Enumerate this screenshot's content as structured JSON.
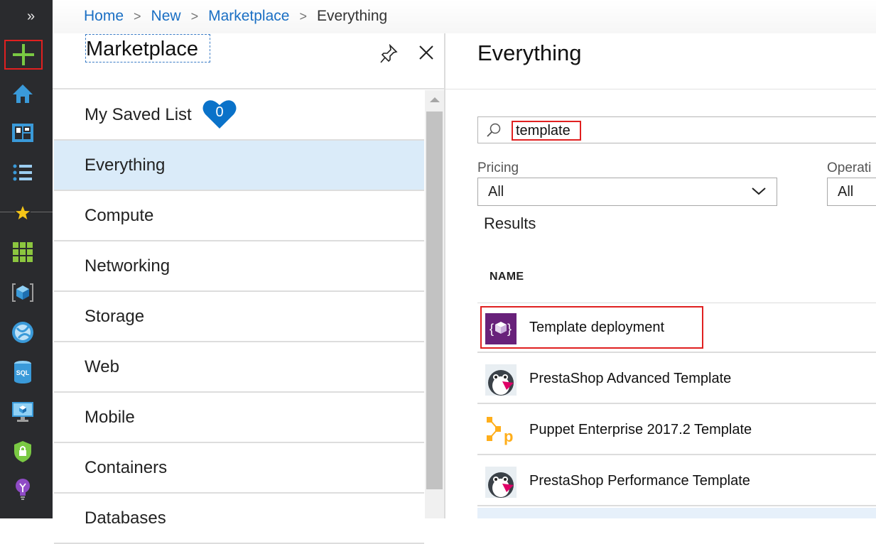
{
  "rail": {
    "expand_icon": "chevrons-right",
    "items": [
      {
        "name": "create-resource",
        "icon": "plus-icon"
      },
      {
        "name": "home",
        "icon": "home-icon"
      },
      {
        "name": "dashboard",
        "icon": "dashboard-icon"
      },
      {
        "name": "all-services",
        "icon": "list-icon"
      },
      {
        "name": "favorites",
        "icon": "star-icon"
      },
      {
        "name": "all-resources",
        "icon": "grid-icon"
      },
      {
        "name": "resource-groups",
        "icon": "cube-icon"
      },
      {
        "name": "app-services",
        "icon": "globe-icon"
      },
      {
        "name": "sql-databases",
        "icon": "sql-icon"
      },
      {
        "name": "virtual-machines",
        "icon": "monitor-icon"
      },
      {
        "name": "security-center",
        "icon": "shield-lock-icon"
      },
      {
        "name": "advisor",
        "icon": "lightbulb-icon"
      }
    ]
  },
  "breadcrumb": {
    "items": [
      "Home",
      "New",
      "Marketplace"
    ],
    "current": "Everything",
    "separator": ">"
  },
  "marketplace": {
    "title": "Marketplace",
    "saved_list": {
      "label": "My Saved List",
      "count": "0"
    },
    "categories": [
      "Everything",
      "Compute",
      "Networking",
      "Storage",
      "Web",
      "Mobile",
      "Containers",
      "Databases"
    ],
    "selected": "Everything"
  },
  "everything": {
    "title": "Everything",
    "search": {
      "value": "template"
    },
    "filters": {
      "pricing": {
        "label": "Pricing",
        "value": "All"
      },
      "operating_system": {
        "label": "Operati",
        "value": "All"
      }
    },
    "results_label": "Results",
    "column_header": "NAME",
    "results": [
      {
        "name": "Template deployment",
        "icon": "template-icon"
      },
      {
        "name": "PrestaShop Advanced Template",
        "icon": "prestashop-icon"
      },
      {
        "name": "Puppet Enterprise 2017.2 Template",
        "icon": "puppet-icon"
      },
      {
        "name": "PrestaShop Performance Template",
        "icon": "prestashop-icon"
      }
    ]
  },
  "colors": {
    "rail_bg": "#2a2b2e",
    "link": "#1a6fc4",
    "selected_bg": "#daebf9",
    "highlight": "#e02020",
    "heart": "#0a72c9"
  }
}
